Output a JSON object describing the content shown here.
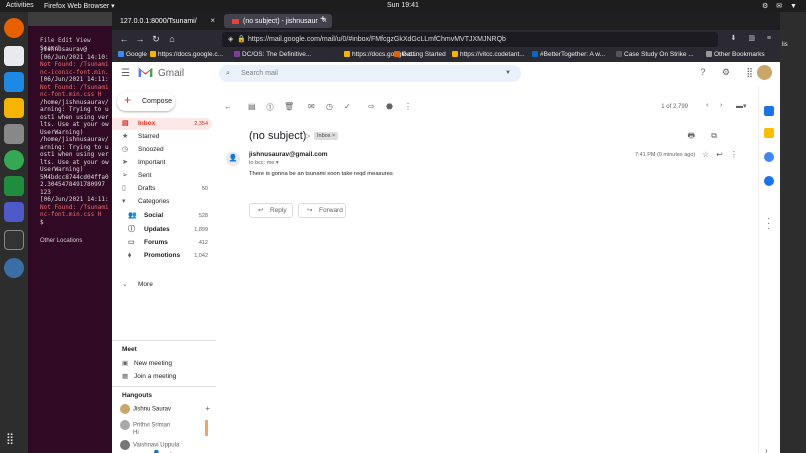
{
  "os": {
    "activities": "Activities",
    "app_name": "Firefox Web Browser ▾",
    "clock": "Sun 19:41"
  },
  "terminal": {
    "menu": "File  Edit  View  Search",
    "lines": [
      "jishnusaurav@",
      "[06/Jun/2021 14:10:",
      "Not Found: /Tsunami",
      "nc-iconic-font.min.",
      "[06/Jun/2021 14:11:",
      "Not Found: /Tsunami",
      "nc-font.min.css H",
      "/home/jishnusaurav/",
      "arning: Trying to u",
      "ost1 when using ver",
      "lts. Use at your ow",
      "  UserWarning)",
      "/home/jishnusaurav/",
      "arning: Trying to u",
      "ost1 when using ver",
      "lts. Use at your ow",
      "  UserWarning)",
      "5M4bdcc8744cd04ffa0",
      "2.3045478491780997",
      "123",
      "[06/Jun/2021 14:11:",
      "Not Found: /Tsunami",
      "nc-font.min.css H",
      "$ "
    ],
    "other_locations": "Other Locations"
  },
  "browser": {
    "tabs": [
      {
        "label": "127.0.0.1:8000/Tsunami/",
        "close": "×"
      },
      {
        "label": "(no subject) - jishnusaur",
        "close": "×"
      }
    ],
    "new_tab": "+",
    "url": "https://mail.google.com/mail/u/0/#inbox/FMfcgzGkXdGcLLmfChmvMVTJXMJNRQb",
    "bookmarks": [
      {
        "label": "Google",
        "color": "#4285f4"
      },
      {
        "label": "https://docs.google.c...",
        "color": "#f4b400"
      },
      {
        "label": "DC/OS: The Definitive...",
        "color": "#7f3f98"
      },
      {
        "label": "https://docs.google.c...",
        "color": "#f4b400"
      },
      {
        "label": "Getting Started",
        "color": "#e66000"
      },
      {
        "label": "https://vitcc.codetant...",
        "color": "#f4b400"
      },
      {
        "label": "#BetterTogether: A w...",
        "color": "#0a66c2"
      },
      {
        "label": "Case Study On Strike ...",
        "color": "#555555"
      },
      {
        "label": "Other Bookmarks",
        "color": "#999999"
      }
    ]
  },
  "gmail": {
    "brand": "Gmail",
    "search_placeholder": "Search mail",
    "compose": "Compose",
    "nav": [
      {
        "label": "Inbox",
        "count": "2,354",
        "icon": "inbox-icon"
      },
      {
        "label": "Starred",
        "count": "",
        "icon": "star-icon"
      },
      {
        "label": "Snoozed",
        "count": "",
        "icon": "clock-icon"
      },
      {
        "label": "Important",
        "count": "",
        "icon": "important-icon"
      },
      {
        "label": "Sent",
        "count": "",
        "icon": "send-icon"
      },
      {
        "label": "Drafts",
        "count": "50",
        "icon": "draft-icon"
      },
      {
        "label": "Categories",
        "count": "",
        "icon": "label-icon"
      }
    ],
    "categories": [
      {
        "label": "Social",
        "count": "528"
      },
      {
        "label": "Updates",
        "count": "1,899"
      },
      {
        "label": "Forums",
        "count": "412"
      },
      {
        "label": "Promotions",
        "count": "1,042"
      }
    ],
    "more": "More",
    "meet": {
      "title": "Meet",
      "new_meeting": "New meeting",
      "join": "Join a meeting"
    },
    "hangouts": {
      "title": "Hangouts",
      "me": "Jishnu Saurav",
      "contacts": [
        {
          "name": "Prithvi Sriman",
          "msg": "Hi"
        },
        {
          "name": "Vaishnavi Uppula",
          "msg": ""
        }
      ]
    },
    "pager": "1 of 2,799",
    "email": {
      "subject": "(no subject)",
      "badge": "Inbox ×",
      "sender": "jishnusaurav@gmail.com",
      "to": "to bcc: me ▾",
      "time": "7:41 PM (0 minutes ago)",
      "body": "There is gonna be an tsunami soon take reqd measures"
    },
    "reply": "Reply",
    "forward": "Forward"
  }
}
